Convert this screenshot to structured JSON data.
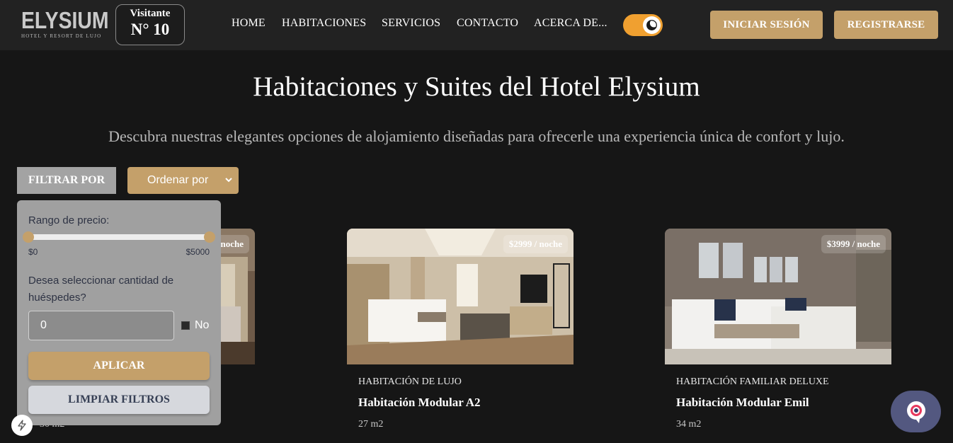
{
  "brand": {
    "name": "ELYSIUM",
    "tagline": "HOTEL Y RESORT DE LUJO"
  },
  "visitor": {
    "label": "Visitante",
    "number": "N° 10"
  },
  "nav": {
    "links": [
      "HOME",
      "HABITACIONES",
      "SERVICIOS",
      "CONTACTO",
      "ACERCA DE..."
    ],
    "theme_toggle_icon": "moon-icon",
    "login_label": "INICIAR SESIÓN",
    "register_label": "REGISTRARSE"
  },
  "hero": {
    "title": "Habitaciones y Suites del Hotel Elysium",
    "subtitle": "Descubra nuestras elegantes opciones de alojamiento diseñadas para ofrecerle una experiencia única de confort y lujo."
  },
  "filters": {
    "filter_button": "FILTRAR POR",
    "sort_placeholder": "Ordenar por",
    "price_label": "Rango de precio:",
    "price_min": "$0",
    "price_max": "$5000",
    "price_range_fraction": [
      0,
      1
    ],
    "guests_question": "Desea seleccionar cantidad de huéspedes?",
    "guests_value": "0",
    "no_label": "No",
    "apply_label": "APLICAR",
    "clear_label": "LIMPIAR FILTROS"
  },
  "rooms": [
    {
      "price": "noche",
      "type": "",
      "name": "",
      "size": "30 m2"
    },
    {
      "price": "$2999 / noche",
      "type": "HABITACIÓN DE LUJO",
      "name": "Habitación Modular A2",
      "size": "27 m2"
    },
    {
      "price": "$3999 / noche",
      "type": "HABITACIÓN FAMILIAR DELUXE",
      "name": "Habitación Modular Emil",
      "size": "34 m2"
    }
  ],
  "colors": {
    "accent_gold": "#c4a06a",
    "toggle_orange": "#f0a030",
    "background": "#161616",
    "navbar": "#222222",
    "chat": "#535880"
  }
}
